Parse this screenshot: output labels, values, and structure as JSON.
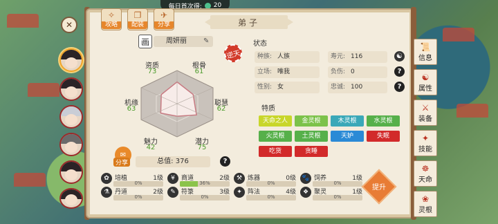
{
  "banner": {
    "label": "每日首次得:",
    "amount": "20"
  },
  "top_tabs": [
    {
      "label": "攻略"
    },
    {
      "label": "配装"
    },
    {
      "label": "分享"
    }
  ],
  "title": "弟子",
  "disciple": {
    "name": "周妍丽",
    "seal": "逆天"
  },
  "stats": {
    "qualification": {
      "name": "资质",
      "value": "73"
    },
    "root_bone": {
      "name": "根骨",
      "value": "61"
    },
    "fortune": {
      "name": "机缘",
      "value": "63"
    },
    "wisdom": {
      "name": "聪慧",
      "value": "62"
    },
    "charm": {
      "name": "魅力",
      "value": "42"
    },
    "potential": {
      "name": "潜力",
      "value": "75"
    },
    "total_label": "总值:",
    "total_value": "376"
  },
  "hex_values": [
    73,
    62,
    75,
    42,
    63,
    61
  ],
  "share_label": "分享",
  "status": {
    "title": "状态",
    "race": {
      "key": "种族:",
      "value": "人族"
    },
    "lifespan": {
      "key": "寿元:",
      "value": "116"
    },
    "stance": {
      "key": "立场:",
      "value": "唯我"
    },
    "debt": {
      "key": "负伤:",
      "value": "0"
    },
    "gender": {
      "key": "性别:",
      "value": "女"
    },
    "loyalty": {
      "key": "忠诚:",
      "value": "100"
    }
  },
  "traits": {
    "title": "特质",
    "items": [
      {
        "label": "天命之人",
        "color": "#c8d62a"
      },
      {
        "label": "金灵根",
        "color": "#7cc24a"
      },
      {
        "label": "木灵根",
        "color": "#3aa8b8"
      },
      {
        "label": "水灵根",
        "color": "#56b04a"
      },
      {
        "label": "火灵根",
        "color": "#56b04a"
      },
      {
        "label": "土灵根",
        "color": "#56b04a"
      },
      {
        "label": "天妒",
        "color": "#2a8ad6"
      },
      {
        "label": "失眠",
        "color": "#d22a2a"
      },
      {
        "label": "吃货",
        "color": "#d22a2a"
      },
      {
        "label": "贪睡",
        "color": "#d22a2a"
      }
    ]
  },
  "skills": [
    {
      "name": "培植",
      "level": "1级",
      "pct": "0%",
      "fill": 0,
      "icon": "✿"
    },
    {
      "name": "商道",
      "level": "2级",
      "pct": "36%",
      "fill": 0.36,
      "icon": "¥"
    },
    {
      "name": "炼器",
      "level": "0级",
      "pct": "0%",
      "fill": 0,
      "icon": "⚒"
    },
    {
      "name": "饲养",
      "level": "1级",
      "pct": "0%",
      "fill": 0,
      "icon": "🐾"
    },
    {
      "name": "丹道",
      "level": "2级",
      "pct": "0%",
      "fill": 0,
      "icon": "⚗"
    },
    {
      "name": "符箓",
      "level": "3级",
      "pct": "0%",
      "fill": 0,
      "icon": "✎"
    },
    {
      "name": "阵法",
      "level": "4级",
      "pct": "0%",
      "fill": 0,
      "icon": "✦"
    },
    {
      "name": "聚灵",
      "level": "1级",
      "pct": "0%",
      "fill": 0,
      "icon": "❖"
    }
  ],
  "upgrade_label": "提升",
  "side_tabs": [
    {
      "label": "信息",
      "icon": "📜"
    },
    {
      "label": "属性",
      "icon": "☯"
    },
    {
      "label": "装备",
      "icon": "⚔"
    },
    {
      "label": "技能",
      "icon": "✦"
    },
    {
      "label": "天命",
      "icon": "☸"
    },
    {
      "label": "灵根",
      "icon": "❀"
    }
  ]
}
